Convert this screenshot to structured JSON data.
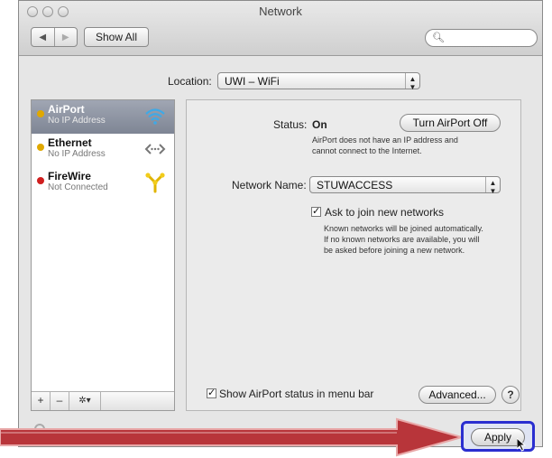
{
  "window": {
    "title": "Network"
  },
  "toolbar": {
    "show_all_label": "Show All"
  },
  "location": {
    "label": "Location:",
    "value": "UWI – WiFi"
  },
  "services": [
    {
      "name": "AirPort",
      "status": "No IP Address",
      "dot_color": "#e0a800",
      "selected": true,
      "icon": "wifi-icon"
    },
    {
      "name": "Ethernet",
      "status": "No IP Address",
      "dot_color": "#e0a800",
      "selected": false,
      "icon": "ethernet-icon"
    },
    {
      "name": "FireWire",
      "status": "Not Connected",
      "dot_color": "#d01f1f",
      "selected": false,
      "icon": "firewire-icon"
    }
  ],
  "sidebar_footer": {
    "add": "+",
    "remove": "–",
    "gear": "✲▾"
  },
  "detail": {
    "status_label": "Status:",
    "status_value": "On",
    "turn_off_label": "Turn AirPort Off",
    "status_desc_1": "AirPort does not have an IP address and",
    "status_desc_2": "cannot connect to the Internet.",
    "network_name_label": "Network Name:",
    "network_name_value": "STUWACCESS",
    "ask_join_label": "Ask to join new networks",
    "ask_join_checked": "✓",
    "ask_desc_1": "Known networks will be joined automatically.",
    "ask_desc_2": "If no known networks are available, you will",
    "ask_desc_3": "be asked before joining a new network."
  },
  "bottom": {
    "show_status_label": "Show AirPort status in menu bar",
    "show_status_checked": "✓",
    "advanced_label": "Advanced...",
    "help_label": "?",
    "apply_label": "Apply"
  },
  "annotation": {
    "arrow_color": "#c0392b",
    "highlight_color": "#2a2ed0"
  }
}
